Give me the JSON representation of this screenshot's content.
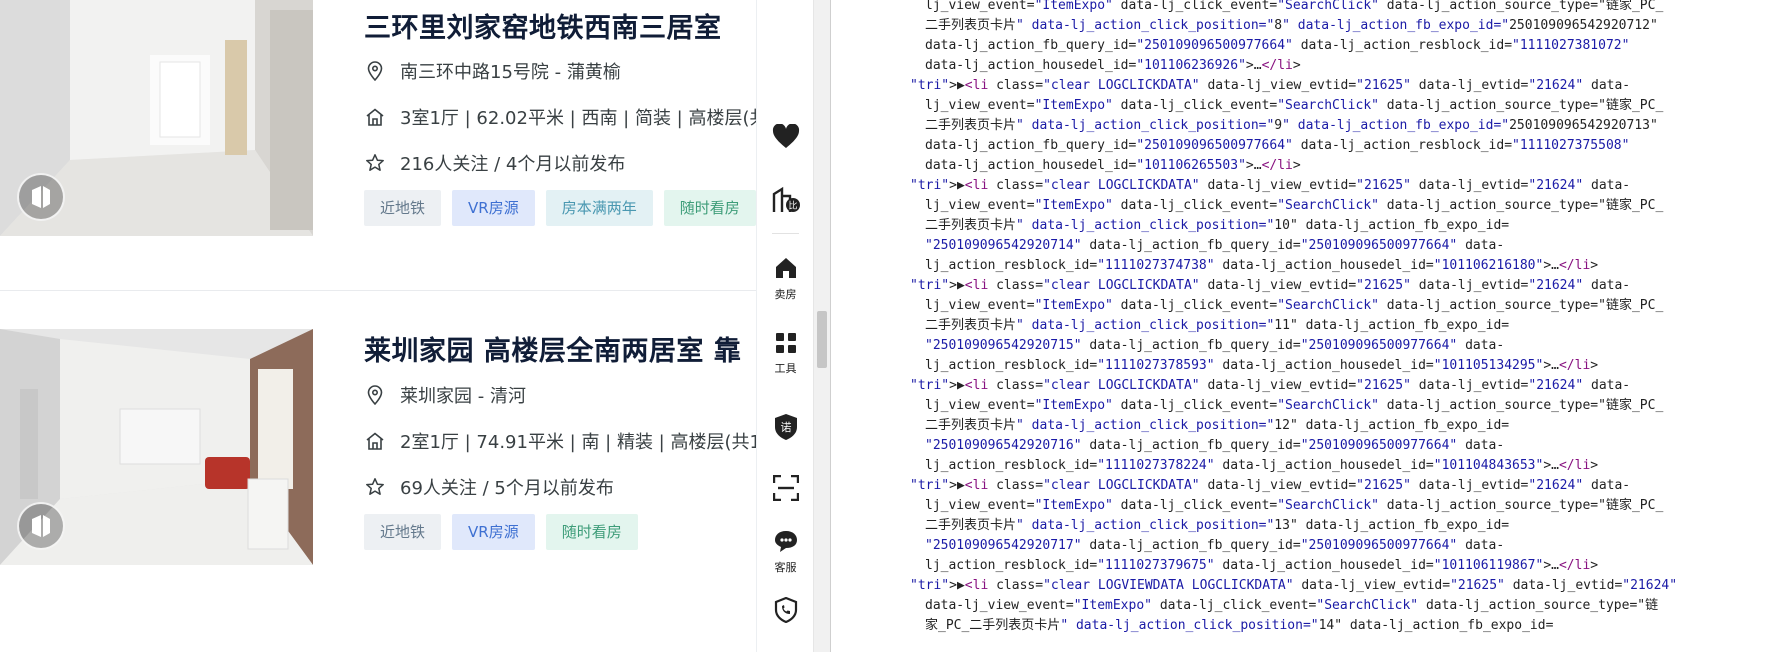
{
  "listings": [
    {
      "title": "三环里刘家窑地铁西南三居室",
      "address": "南三环中路15号院 - 蒲黄榆",
      "info": "3室1厅 | 62.02平米 | 西南 | 简装 | 高楼层(共",
      "follow": "216人关注 / 4个月以前发布",
      "tags": [
        "近地铁",
        "VR房源",
        "房本满两年",
        "随时看房"
      ]
    },
    {
      "title": "莱圳家园 高楼层全南两居室 靠",
      "address": "莱圳家园 - 清河",
      "info": "2室1厅 | 74.91平米 | 南 | 精装 | 高楼层(共1",
      "follow": "69人关注 / 5个月以前发布",
      "tags": [
        "近地铁",
        "VR房源",
        "随时看房"
      ]
    }
  ],
  "toolbar": {
    "items": [
      {
        "icon": "heart-icon",
        "label": ""
      },
      {
        "icon": "compare-icon",
        "label": ""
      },
      {
        "icon": "sell-house-icon",
        "label": "卖房"
      },
      {
        "icon": "tools-icon",
        "label": "工具"
      },
      {
        "icon": "guarantee-icon",
        "label": ""
      },
      {
        "icon": "scan-icon",
        "label": ""
      },
      {
        "icon": "customer-service-icon",
        "label": "客服"
      },
      {
        "icon": "report-phone-icon",
        "label": ""
      }
    ]
  },
  "devtools": {
    "colors": {
      "tag": "#881280",
      "attr": "#994500",
      "value": "#1a1aa6"
    },
    "lines": [
      "lj_view_event=\"ItemExpo\" data-lj_click_event=\"SearchClick\" data-lj_action_source_type=\"链家_PC_",
      "二手列表页卡片\" data-lj_action_click_position=\"8\" data-lj_action_fb_expo_id=\"250109096542920712\"",
      "data-lj_action_fb_query_id=\"250109096500977664\" data-lj_action_resblock_id=\"1111027381072\"",
      "data-lj_action_housedel_id=\"101106236926\">…</li>",
      "▶<li class=\"clear LOGCLICKDATA\" data-lj_view_evtid=\"21625\" data-lj_evtid=\"21624\" data-",
      "lj_view_event=\"ItemExpo\" data-lj_click_event=\"SearchClick\" data-lj_action_source_type=\"链家_PC_",
      "二手列表页卡片\" data-lj_action_click_position=\"9\" data-lj_action_fb_expo_id=\"250109096542920713\"",
      "data-lj_action_fb_query_id=\"250109096500977664\" data-lj_action_resblock_id=\"1111027375508\"",
      "data-lj_action_housedel_id=\"101106265503\">…</li>",
      "▶<li class=\"clear LOGCLICKDATA\" data-lj_view_evtid=\"21625\" data-lj_evtid=\"21624\" data-",
      "lj_view_event=\"ItemExpo\" data-lj_click_event=\"SearchClick\" data-lj_action_source_type=\"链家_PC_",
      "二手列表页卡片\" data-lj_action_click_position=\"10\" data-lj_action_fb_expo_id=",
      "\"250109096542920714\" data-lj_action_fb_query_id=\"250109096500977664\" data-",
      "lj_action_resblock_id=\"1111027374738\" data-lj_action_housedel_id=\"101106216180\">…</li>",
      "▶<li class=\"clear LOGCLICKDATA\" data-lj_view_evtid=\"21625\" data-lj_evtid=\"21624\" data-",
      "lj_view_event=\"ItemExpo\" data-lj_click_event=\"SearchClick\" data-lj_action_source_type=\"链家_PC_",
      "二手列表页卡片\" data-lj_action_click_position=\"11\" data-lj_action_fb_expo_id=",
      "\"250109096542920715\" data-lj_action_fb_query_id=\"250109096500977664\" data-",
      "lj_action_resblock_id=\"1111027378593\" data-lj_action_housedel_id=\"101105134295\">…</li>",
      "▶<li class=\"clear LOGCLICKDATA\" data-lj_view_evtid=\"21625\" data-lj_evtid=\"21624\" data-",
      "lj_view_event=\"ItemExpo\" data-lj_click_event=\"SearchClick\" data-lj_action_source_type=\"链家_PC_",
      "二手列表页卡片\" data-lj_action_click_position=\"12\" data-lj_action_fb_expo_id=",
      "\"250109096542920716\" data-lj_action_fb_query_id=\"250109096500977664\" data-",
      "lj_action_resblock_id=\"1111027378224\" data-lj_action_housedel_id=\"101104843653\">…</li>",
      "▶<li class=\"clear LOGCLICKDATA\" data-lj_view_evtid=\"21625\" data-lj_evtid=\"21624\" data-",
      "lj_view_event=\"ItemExpo\" data-lj_click_event=\"SearchClick\" data-lj_action_source_type=\"链家_PC_",
      "二手列表页卡片\" data-lj_action_click_position=\"13\" data-lj_action_fb_expo_id=",
      "\"250109096542920717\" data-lj_action_fb_query_id=\"250109096500977664\" data-",
      "lj_action_resblock_id=\"1111027379675\" data-lj_action_housedel_id=\"101106119867\">…</li>",
      "▶<li class=\"clear LOGVIEWDATA LOGCLICKDATA\" data-lj_view_evtid=\"21625\" data-lj_evtid=\"21624\"",
      "data-lj_view_event=\"ItemExpo\" data-lj_click_event=\"SearchClick\" data-lj_action_source_type=\"链",
      "家_PC_二手列表页卡片\" data-lj_action_click_position=\"14\" data-lj_action_fb_expo_id="
    ]
  }
}
